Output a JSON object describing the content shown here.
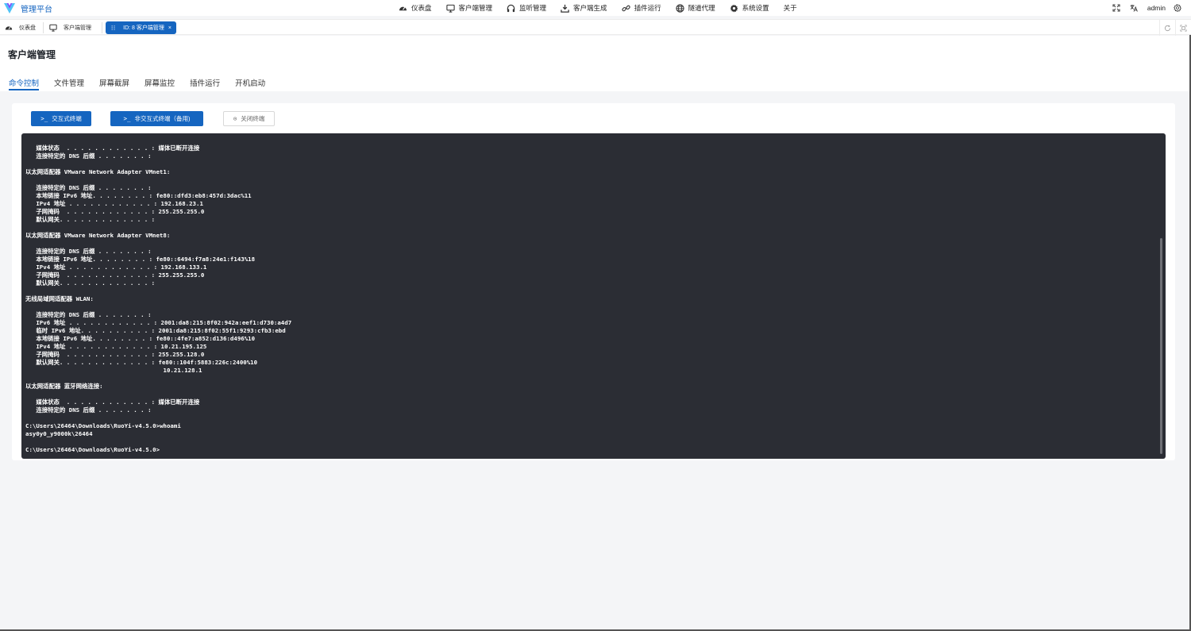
{
  "app": {
    "brand": "管理平台"
  },
  "nav": [
    {
      "label": "仪表盘",
      "icon": "dashboard-icon"
    },
    {
      "label": "客户端管理",
      "icon": "monitor-icon"
    },
    {
      "label": "监听管理",
      "icon": "headphones-icon"
    },
    {
      "label": "客户端生成",
      "icon": "download-icon"
    },
    {
      "label": "插件运行",
      "icon": "link-icon"
    },
    {
      "label": "隧道代理",
      "icon": "globe-icon"
    },
    {
      "label": "系统设置",
      "icon": "gear-icon"
    },
    {
      "label": "关于",
      "icon": ""
    }
  ],
  "user": {
    "name": "admin"
  },
  "tabs": [
    {
      "label": "仪表盘",
      "icon": "dashboard-icon"
    },
    {
      "label": "客户端管理",
      "icon": "monitor-icon"
    },
    {
      "label": "ID: 8 客户端管理",
      "icon": "drag-handle-icon",
      "close": "×"
    }
  ],
  "page": {
    "title": "客户端管理",
    "subtabs": [
      "命令控制",
      "文件管理",
      "屏幕截屏",
      "屏幕监控",
      "插件运行",
      "开机启动"
    ]
  },
  "toolbar": {
    "interactive_terminal": "交互式终端",
    "noninteractive_terminal": "非交互式终端（备用)",
    "close_terminal": "关闭终端",
    "prompt_glyph": ">_",
    "close_glyph": "⊙"
  },
  "terminal": {
    "lines": [
      "   媒体状态  . . . . . . . . . . . . : 媒体已断开连接",
      "   连接特定的 DNS 后缀 . . . . . . . :",
      "",
      "以太网适配器 VMware Network Adapter VMnet1:",
      "",
      "   连接特定的 DNS 后缀 . . . . . . . :",
      "   本地链接 IPv6 地址. . . . . . . . : fe80::dfd3:eb8:457d:3dac%11",
      "   IPv4 地址 . . . . . . . . . . . . : 192.168.23.1",
      "   子网掩码  . . . . . . . . . . . . : 255.255.255.0",
      "   默认网关. . . . . . . . . . . . . :",
      "",
      "以太网适配器 VMware Network Adapter VMnet8:",
      "",
      "   连接特定的 DNS 后缀 . . . . . . . :",
      "   本地链接 IPv6 地址. . . . . . . . : fe80::6494:f7a8:24e1:f143%18",
      "   IPv4 地址 . . . . . . . . . . . . : 192.168.133.1",
      "   子网掩码  . . . . . . . . . . . . : 255.255.255.0",
      "   默认网关. . . . . . . . . . . . . :",
      "",
      "无线局域网适配器 WLAN:",
      "",
      "   连接特定的 DNS 后缀 . . . . . . . :",
      "   IPv6 地址 . . . . . . . . . . . . : 2001:da8:215:8f02:942a:eef1:d730:a4d7",
      "   临时 IPv6 地址. . . . . . . . . . : 2001:da8:215:8f02:55f1:9293:cfb3:ebd",
      "   本地链接 IPv6 地址. . . . . . . . : fe80::4fe7:a852:d136:d496%10",
      "   IPv4 地址 . . . . . . . . . . . . : 10.21.195.125",
      "   子网掩码  . . . . . . . . . . . . : 255.255.128.0",
      "   默认网关. . . . . . . . . . . . . : fe80::104f:5883:226c:2400%10",
      "                                       10.21.128.1",
      "",
      "以太网适配器 蓝牙网络连接:",
      "",
      "   媒体状态  . . . . . . . . . . . . : 媒体已断开连接",
      "   连接特定的 DNS 后缀 . . . . . . . :",
      "",
      "C:\\Users\\26464\\Downloads\\RuoYi-v4.5.0>whoami",
      "asy0y0_y9000k\\26464",
      "",
      "C:\\Users\\26464\\Downloads\\RuoYi-v4.5.0>"
    ]
  },
  "colors": {
    "accent": "#1565c0",
    "terminal_bg": "#2b2d34"
  }
}
